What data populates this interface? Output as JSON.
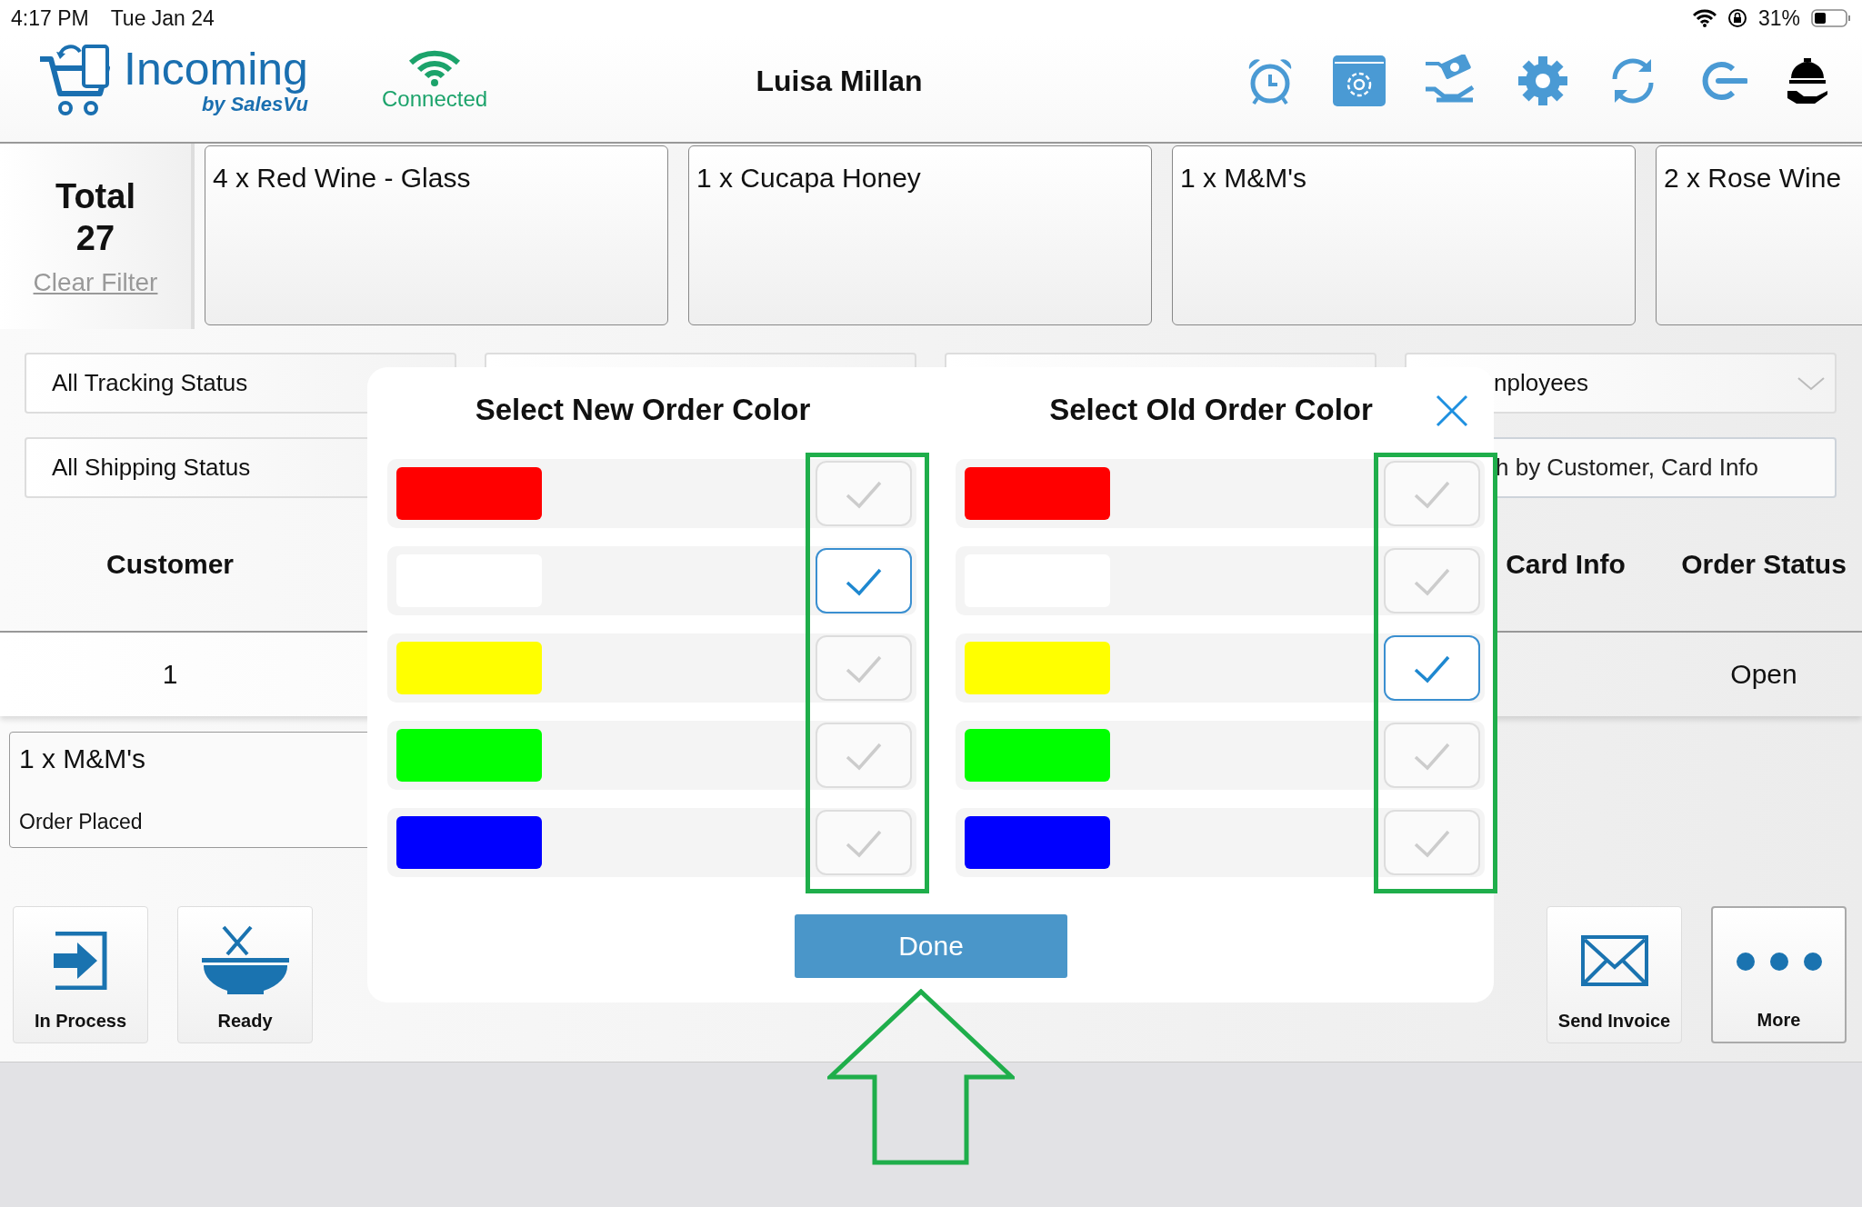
{
  "status_bar": {
    "time": "4:17 PM",
    "date": "Tue Jan 24",
    "battery": "31%"
  },
  "header": {
    "app_name": "Incoming",
    "app_byline": "by SalesVu",
    "connection": "Connected",
    "user": "Luisa Millan"
  },
  "summary": {
    "label": "Total",
    "count": "27",
    "clear_filter": "Clear Filter"
  },
  "order_cards": [
    {
      "text": "4 x Red Wine - Glass"
    },
    {
      "text": "1 x Cucapa Honey"
    },
    {
      "text": "1 x M&M's"
    },
    {
      "text": "2 x Rose Wine"
    }
  ],
  "filters": {
    "row_1": [
      {
        "kind": "dropdown",
        "value": "All Tracking Status"
      },
      {
        "kind": "dropdown"
      },
      {
        "kind": "dropdown"
      },
      {
        "kind": "dropdown",
        "value": "nployees"
      }
    ],
    "row_2": [
      {
        "kind": "dropdown",
        "value": "All Shipping Status"
      },
      {
        "kind": "search",
        "placeholder": "h by Customer, Card Info"
      }
    ]
  },
  "table": {
    "columns": [
      {
        "label": "Customer"
      },
      {
        "label": "Card Info"
      },
      {
        "label": "Order Status"
      }
    ],
    "rows": [
      {
        "customer": "1",
        "order_status": "Open"
      }
    ]
  },
  "order_detail": {
    "item": "1 x M&M's",
    "status": "Order Placed"
  },
  "actions_left": [
    {
      "kind": "in_process",
      "label": "In Process"
    },
    {
      "kind": "ready",
      "label": "Ready"
    }
  ],
  "actions_right": [
    {
      "kind": "send_invoice",
      "label": "Send Invoice"
    },
    {
      "kind": "more",
      "label": "More"
    }
  ],
  "color_dialog": {
    "columns": [
      {
        "title": "Select New Order Color",
        "highlighted": true,
        "options": [
          {
            "color": "#ff0000",
            "selected": false
          },
          {
            "color": "#ffffff",
            "selected": true
          },
          {
            "color": "#ffff00",
            "selected": false
          },
          {
            "color": "#00ff00",
            "selected": false
          },
          {
            "color": "#0000ff",
            "selected": false
          }
        ]
      },
      {
        "title": "Select Old Order Color",
        "highlighted": true,
        "options": [
          {
            "color": "#ff0000",
            "selected": false
          },
          {
            "color": "#ffffff",
            "selected": false
          },
          {
            "color": "#ffff00",
            "selected": true
          },
          {
            "color": "#00ff00",
            "selected": false
          },
          {
            "color": "#0000ff",
            "selected": false
          }
        ]
      }
    ],
    "done": "Done"
  },
  "annotations": [
    {
      "kind": "arrow"
    }
  ]
}
